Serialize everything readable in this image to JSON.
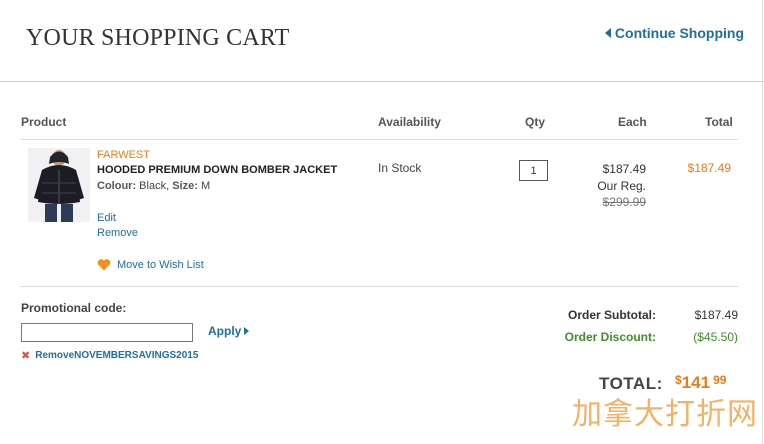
{
  "header": {
    "title": "YOUR SHOPPING CART",
    "continue_label": "Continue Shopping"
  },
  "columns": {
    "product": "Product",
    "availability": "Availability",
    "qty": "Qty",
    "each": "Each",
    "total": "Total"
  },
  "item": {
    "brand": "FARWEST",
    "name": "HOODED PREMIUM DOWN BOMBER JACKET",
    "colour_label": "Colour:",
    "colour": "Black,",
    "size_label": "Size:",
    "size": "M",
    "edit_label": "Edit",
    "remove_label": "Remove",
    "wishlist_label": "Move to Wish List",
    "availability": "In Stock",
    "qty": "1",
    "each_price": "$187.49",
    "reg_label": "Our Reg.",
    "reg_price": "$299.99",
    "total": "$187.49"
  },
  "promo": {
    "label": "Promotional code:",
    "value": "",
    "apply_label": "Apply",
    "remove_code_label": "RemoveNOVEMBERSAVINGS2015"
  },
  "summary": {
    "subtotal_label": "Order Subtotal:",
    "subtotal": "$187.49",
    "discount_label": "Order Discount:",
    "discount": "($45.50)",
    "total_label": "TOTAL:",
    "total_currency": "$",
    "total_dollars": "141",
    "total_cents": "99"
  },
  "watermark": "加拿大打折网",
  "colors": {
    "link": "#1f6f9e",
    "accent": "#e07f1b",
    "discount": "#3f8f2a"
  }
}
